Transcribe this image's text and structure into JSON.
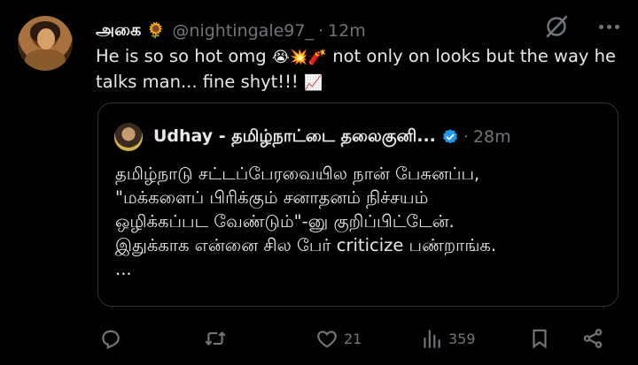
{
  "tweet": {
    "display_name": "அகை",
    "name_emoji": "🌻",
    "handle": "@nightingale97_",
    "separator": "·",
    "time": "12m",
    "text_part1": "He is so so hot omg ",
    "emojis_1": "😭💥🧨",
    "text_part2": " not only on looks but the way he talks man... fine shyt!!! ",
    "emoji_chart": "📈"
  },
  "quote": {
    "display_name": "Udhay - தமிழ்நாட்டை தலைகுனி...",
    "separator": "·",
    "time": "28m",
    "lines": [
      "தமிழ்நாடு சட்டப்பேரவையில நான் பேசுனப்ப,",
      "\"மக்களைப் பிரிக்கும் சனாதனம் நிச்சயம்",
      "ஒழிக்கப்பட வேண்டும்\"-னு குறிப்பிட்டேன்.",
      "இதுக்காக என்னை சில பேர் criticize பண்றாங்க.",
      "..."
    ]
  },
  "actions": {
    "likes": "21",
    "views": "359"
  },
  "colors": {
    "background": "#000000",
    "text": "#e7e9ea",
    "muted": "#71767b",
    "border": "#2f3336",
    "verified": "#1d9bf0"
  },
  "icons": [
    "grok-icon",
    "more-icon",
    "verified-icon",
    "reply-icon",
    "retweet-icon",
    "like-icon",
    "views-icon",
    "bookmark-icon",
    "share-icon"
  ]
}
